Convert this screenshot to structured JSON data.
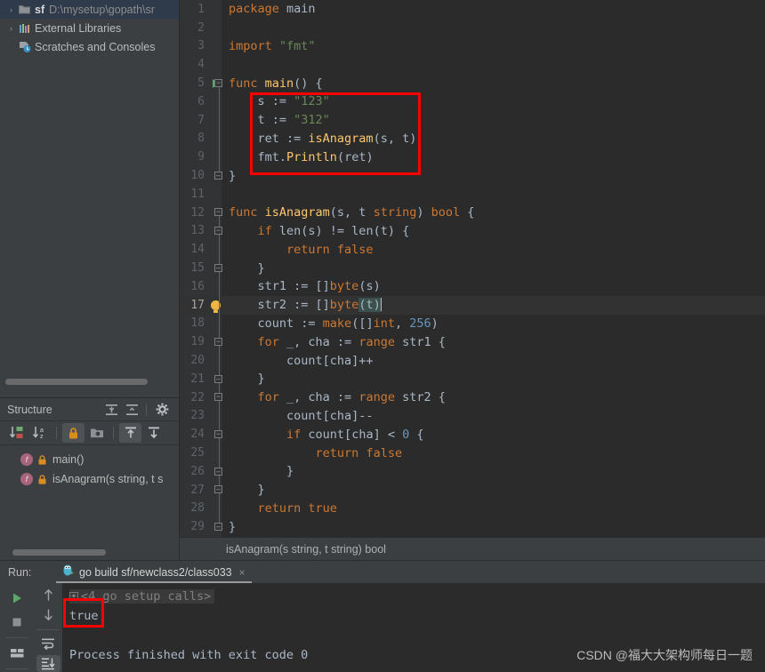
{
  "project_tree": {
    "items": [
      {
        "label_bold": "sf",
        "label_path": "D:\\mysetup\\gopath\\sr",
        "icon": "folder-icon",
        "arrow": "›",
        "selected": true
      },
      {
        "label_plain": "External Libraries",
        "icon": "libraries-icon",
        "arrow": "›",
        "selected": false
      },
      {
        "label_plain": "Scratches and Consoles",
        "icon": "scratches-icon",
        "arrow": "",
        "selected": false
      }
    ]
  },
  "structure": {
    "title": "Structure",
    "header_icons": [
      "expand-all-icon",
      "collapse-all-icon",
      "settings-gear-icon"
    ],
    "toolbar_icons": [
      "sort-by-visibility-icon",
      "sort-alphabetically-icon",
      "show-non-public-icon",
      "show-anonymous-classes-icon",
      "show-inherited-icon",
      "show-fields-icon"
    ],
    "items": [
      {
        "name": "main()",
        "icon": "function-icon",
        "modifier": "lock-icon"
      },
      {
        "name": "isAnagram(s string, t s",
        "icon": "function-icon",
        "modifier": "lock-icon"
      }
    ]
  },
  "editor": {
    "lines": [
      {
        "n": "1",
        "tokens": [
          {
            "t": "package ",
            "c": "kw"
          },
          {
            "t": "main",
            "c": "id"
          }
        ],
        "indent": 0
      },
      {
        "n": "2",
        "tokens": [],
        "indent": 0
      },
      {
        "n": "3",
        "tokens": [
          {
            "t": "import ",
            "c": "kw"
          },
          {
            "t": "\"fmt\"",
            "c": "str"
          }
        ],
        "indent": 0
      },
      {
        "n": "4",
        "tokens": [],
        "indent": 0
      },
      {
        "n": "5",
        "tokens": [
          {
            "t": "func ",
            "c": "kw"
          },
          {
            "t": "main",
            "c": "fn"
          },
          {
            "t": "() {",
            "c": "id"
          }
        ],
        "indent": 0,
        "gutter": "run-arrow",
        "fold": "open"
      },
      {
        "n": "6",
        "tokens": [
          {
            "t": "    s := ",
            "c": "id"
          },
          {
            "t": "\"123\"",
            "c": "str"
          }
        ],
        "indent": 1
      },
      {
        "n": "7",
        "tokens": [
          {
            "t": "    t := ",
            "c": "id"
          },
          {
            "t": "\"312\"",
            "c": "str"
          }
        ],
        "indent": 1
      },
      {
        "n": "8",
        "tokens": [
          {
            "t": "    ret := ",
            "c": "id"
          },
          {
            "t": "isAnagram",
            "c": "fn"
          },
          {
            "t": "(s, t)",
            "c": "id"
          }
        ],
        "indent": 1
      },
      {
        "n": "9",
        "tokens": [
          {
            "t": "    fmt.",
            "c": "id"
          },
          {
            "t": "Println",
            "c": "fn"
          },
          {
            "t": "(ret)",
            "c": "id"
          }
        ],
        "indent": 1
      },
      {
        "n": "10",
        "tokens": [
          {
            "t": "}",
            "c": "id"
          }
        ],
        "indent": 0,
        "fold": "close"
      },
      {
        "n": "11",
        "tokens": [],
        "indent": 0
      },
      {
        "n": "12",
        "tokens": [
          {
            "t": "func ",
            "c": "kw"
          },
          {
            "t": "isAnagram",
            "c": "fn"
          },
          {
            "t": "(s, t ",
            "c": "id"
          },
          {
            "t": "string",
            "c": "kw"
          },
          {
            "t": ") ",
            "c": "id"
          },
          {
            "t": "bool",
            "c": "kw"
          },
          {
            "t": " {",
            "c": "id"
          }
        ],
        "indent": 0,
        "fold": "open"
      },
      {
        "n": "13",
        "tokens": [
          {
            "t": "    ",
            "c": "id"
          },
          {
            "t": "if ",
            "c": "kw"
          },
          {
            "t": "len(s) != len(t) {",
            "c": "id"
          }
        ],
        "indent": 1,
        "fold": "open-sub"
      },
      {
        "n": "14",
        "tokens": [
          {
            "t": "        ",
            "c": "id"
          },
          {
            "t": "return false",
            "c": "kw"
          }
        ],
        "indent": 2
      },
      {
        "n": "15",
        "tokens": [
          {
            "t": "    }",
            "c": "id"
          }
        ],
        "indent": 1,
        "fold": "close-sub"
      },
      {
        "n": "16",
        "tokens": [
          {
            "t": "    str1 := []",
            "c": "id"
          },
          {
            "t": "byte",
            "c": "kw"
          },
          {
            "t": "(s)",
            "c": "id"
          }
        ],
        "indent": 1
      },
      {
        "n": "17",
        "tokens": [
          {
            "t": "    str2 := []",
            "c": "id"
          },
          {
            "t": "byte",
            "c": "kw"
          },
          {
            "t": "(t)",
            "c": "hl"
          }
        ],
        "indent": 1,
        "caret": true,
        "gutter": "bulb"
      },
      {
        "n": "18",
        "tokens": [
          {
            "t": "    count := ",
            "c": "id"
          },
          {
            "t": "make",
            "c": "kw"
          },
          {
            "t": "([]",
            "c": "id"
          },
          {
            "t": "int",
            "c": "kw"
          },
          {
            "t": ", ",
            "c": "id"
          },
          {
            "t": "256",
            "c": "num"
          },
          {
            "t": ")",
            "c": "id"
          }
        ],
        "indent": 1
      },
      {
        "n": "19",
        "tokens": [
          {
            "t": "    ",
            "c": "id"
          },
          {
            "t": "for ",
            "c": "kw"
          },
          {
            "t": "_, cha := ",
            "c": "id"
          },
          {
            "t": "range ",
            "c": "kw"
          },
          {
            "t": "str1 {",
            "c": "id"
          }
        ],
        "indent": 1,
        "fold": "open-sub"
      },
      {
        "n": "20",
        "tokens": [
          {
            "t": "        count[cha]++",
            "c": "id"
          }
        ],
        "indent": 2
      },
      {
        "n": "21",
        "tokens": [
          {
            "t": "    }",
            "c": "id"
          }
        ],
        "indent": 1,
        "fold": "close-sub"
      },
      {
        "n": "22",
        "tokens": [
          {
            "t": "    ",
            "c": "id"
          },
          {
            "t": "for ",
            "c": "kw"
          },
          {
            "t": "_, cha := ",
            "c": "id"
          },
          {
            "t": "range ",
            "c": "kw"
          },
          {
            "t": "str2 {",
            "c": "id"
          }
        ],
        "indent": 1,
        "fold": "open-sub"
      },
      {
        "n": "23",
        "tokens": [
          {
            "t": "        count[cha]--",
            "c": "id"
          }
        ],
        "indent": 2
      },
      {
        "n": "24",
        "tokens": [
          {
            "t": "        ",
            "c": "id"
          },
          {
            "t": "if ",
            "c": "kw"
          },
          {
            "t": "count[cha] < ",
            "c": "id"
          },
          {
            "t": "0",
            "c": "num"
          },
          {
            "t": " {",
            "c": "id"
          }
        ],
        "indent": 2,
        "fold": "open-sub"
      },
      {
        "n": "25",
        "tokens": [
          {
            "t": "            ",
            "c": "id"
          },
          {
            "t": "return false",
            "c": "kw"
          }
        ],
        "indent": 3
      },
      {
        "n": "26",
        "tokens": [
          {
            "t": "        }",
            "c": "id"
          }
        ],
        "indent": 2,
        "fold": "close-sub"
      },
      {
        "n": "27",
        "tokens": [
          {
            "t": "    }",
            "c": "id"
          }
        ],
        "indent": 1,
        "fold": "close-sub"
      },
      {
        "n": "28",
        "tokens": [
          {
            "t": "    ",
            "c": "id"
          },
          {
            "t": "return true",
            "c": "kw"
          }
        ],
        "indent": 1
      },
      {
        "n": "29",
        "tokens": [
          {
            "t": "}",
            "c": "id"
          }
        ],
        "indent": 0,
        "fold": "close"
      }
    ]
  },
  "breadcrumb": {
    "text": "isAnagram(s string, t string) bool"
  },
  "run_panel": {
    "run_label": "Run:",
    "tab_title": "go build sf/newclass2/class033",
    "tab_close": "×",
    "toolbar_left": [
      "run-icon",
      "stop-icon",
      "layout-icon"
    ],
    "toolbar_second": [
      "up-arrow-icon",
      "down-arrow-icon",
      "soft-wrap-icon",
      "scroll-to-end-icon"
    ],
    "console": {
      "collapsed_line": "<4 go setup calls>",
      "output_line": "true",
      "finish_line": "Process finished with exit code 0"
    }
  },
  "watermark": {
    "text": "CSDN @福大大架构师每日一题"
  },
  "colors": {
    "accent_red": "#fe0000",
    "keyword": "#cc7832",
    "string": "#6a8759",
    "number": "#6897bb",
    "function": "#ffc66d",
    "default_text": "#a9b7c6",
    "editor_bg": "#2b2b2b",
    "panel_bg": "#3c3f41"
  }
}
